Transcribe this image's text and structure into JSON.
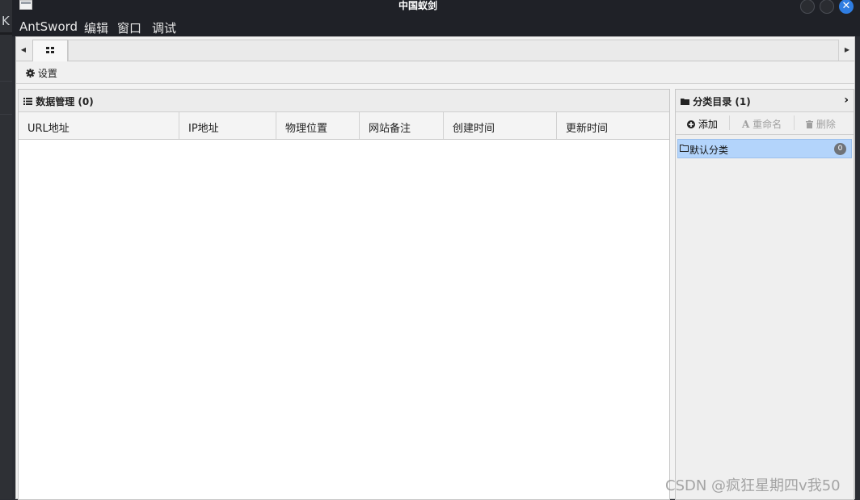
{
  "window": {
    "title": "中国蚁剑",
    "close_glyph": "✕"
  },
  "menu": {
    "items": [
      "AntSword",
      "编辑",
      "窗口",
      "调试"
    ]
  },
  "desktop": {
    "edge_letter": "K"
  },
  "tabs": {
    "left_arrow": "◀",
    "right_arrow": "▶"
  },
  "toolbar": {
    "settings_label": "设置"
  },
  "data_panel": {
    "title": "数据管理 (0)",
    "columns": [
      "URL地址",
      "IP地址",
      "物理位置",
      "网站备注",
      "创建时间",
      "更新时间"
    ]
  },
  "category_panel": {
    "title": "分类目录 (1)",
    "expand_glyph": "›",
    "add_label": "添加",
    "rename_label": "重命名",
    "delete_label": "删除",
    "items": [
      {
        "label": "默认分类",
        "count": "0"
      }
    ]
  },
  "watermark": "CSDN @疯狂星期四v我50",
  "colors": {
    "selected_row": "#b3d4fb",
    "close_button": "#2f7de1",
    "titlebar": "#1f2127"
  },
  "icons": [
    "grid-icon",
    "gear-icon",
    "list-icon",
    "folder-icon",
    "plus-circle-icon",
    "font-icon",
    "trash-icon",
    "folder-outline-icon",
    "chevron-right-icon"
  ]
}
